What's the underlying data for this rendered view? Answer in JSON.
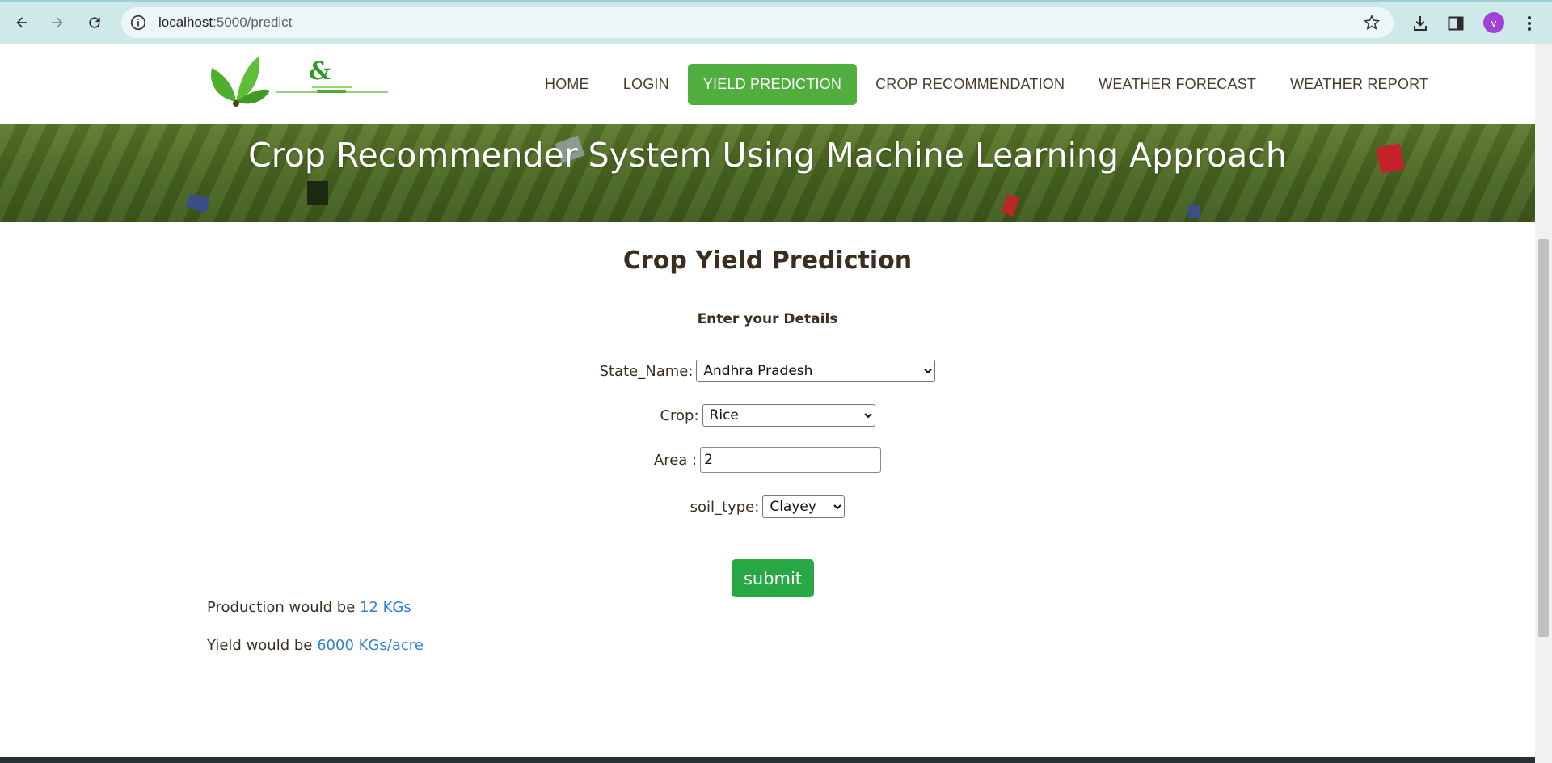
{
  "browser": {
    "url_host": "localhost",
    "url_path": ":5000/predict",
    "avatar_letter": "v"
  },
  "nav": {
    "items": [
      {
        "label": "HOME",
        "active": false
      },
      {
        "label": "LOGIN",
        "active": false
      },
      {
        "label": "YIELD PREDICTION",
        "active": true
      },
      {
        "label": "CROP RECOMMENDATION",
        "active": false
      },
      {
        "label": "WEATHER FORECAST",
        "active": false
      },
      {
        "label": "WEATHER REPORT",
        "active": false
      }
    ],
    "active_color": "#4fae3e"
  },
  "banner": {
    "title": "Crop Recommender System Using Machine Learning Approach"
  },
  "form": {
    "title": "Crop Yield Prediction",
    "subtitle": "Enter your Details",
    "state": {
      "label": "State_Name:",
      "value": "Andhra Pradesh"
    },
    "crop": {
      "label": "Crop:",
      "value": "Rice"
    },
    "area": {
      "label": "Area :",
      "value": "2"
    },
    "soil": {
      "label": "soil_type:",
      "value": "Clayey"
    },
    "submit_label": "submit",
    "submit_color": "#28a745"
  },
  "results": {
    "production_prefix": "Production would be ",
    "production_value": "12 KGs",
    "yield_prefix": "Yield would be ",
    "yield_value": "6000 KGs/acre",
    "value_color": "#2f7fd8"
  }
}
